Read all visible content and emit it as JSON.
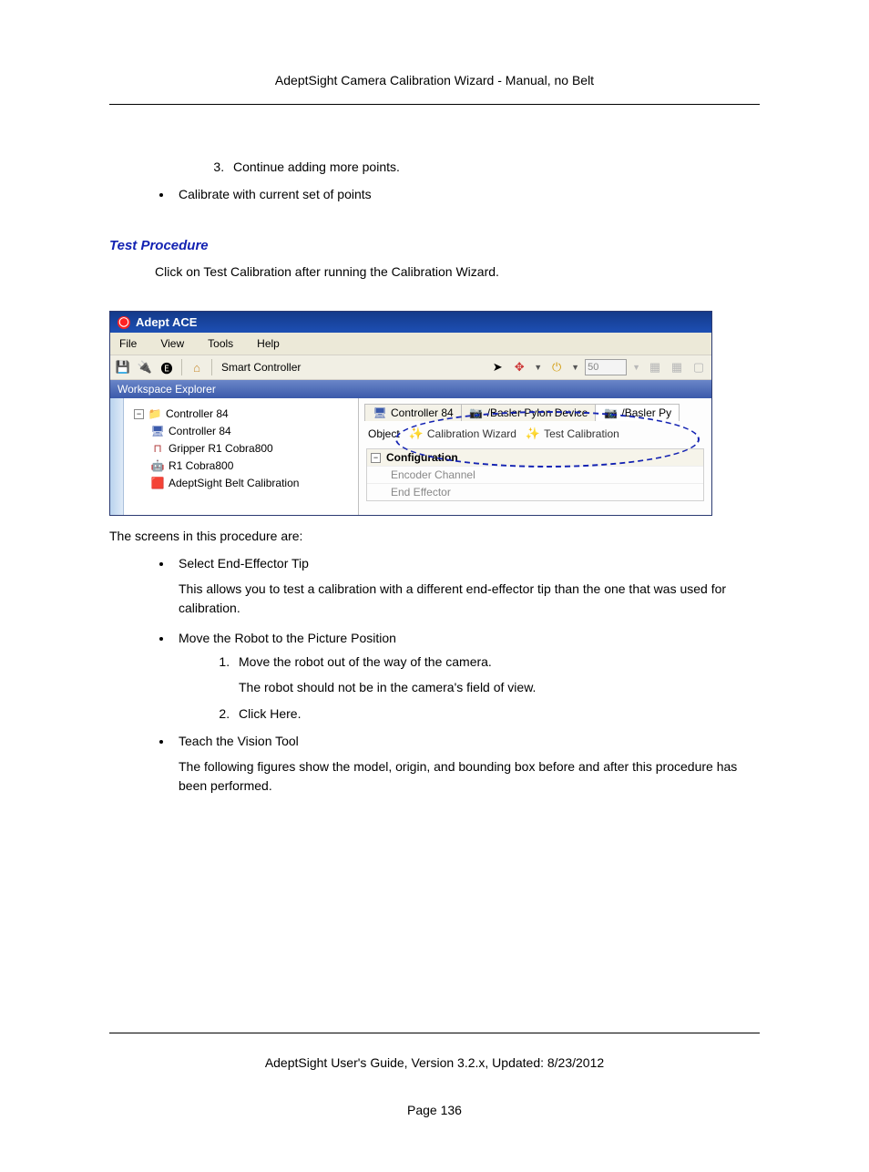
{
  "header": {
    "title": "AdeptSight Camera Calibration Wizard - Manual, no Belt"
  },
  "top_list": {
    "ol3": "Continue adding more points.",
    "bullet": "Calibrate with current set of points"
  },
  "section": {
    "heading": "Test Procedure",
    "intro": "Click on Test Calibration after running the Calibration Wizard."
  },
  "screenshot": {
    "app_title": "Adept ACE",
    "menus": {
      "file": "File",
      "view": "View",
      "tools": "Tools",
      "help": "Help"
    },
    "toolbar": {
      "smart_controller": "Smart Controller",
      "speed_value": "50"
    },
    "workspace_header": "Workspace Explorer",
    "tree": {
      "root": "Controller 84",
      "ctrl": "Controller 84",
      "gripper": "Gripper R1 Cobra800",
      "r1": "R1 Cobra800",
      "belt": "AdeptSight Belt Calibration"
    },
    "tabs": {
      "t1": "Controller 84",
      "t2": "/Basler Pylon Device",
      "t3": "/Basler Py"
    },
    "subbar": {
      "object": "Object",
      "calib": "Calibration Wizard",
      "test": "Test Calibration"
    },
    "config": {
      "title": "Configuration",
      "enc": "Encoder Channel",
      "eff": "End Effector"
    }
  },
  "after": {
    "lead": "The screens in this procedure are:",
    "b1_title": "Select End-Effector Tip",
    "b1_body": "This allows you to test a calibration with a different end-effector tip than the one that was used for calibration.",
    "b2_title": "Move the Robot to the Picture Position",
    "b2_ol1": "Move the robot out of the way of the camera.",
    "b2_ol1_body": "The robot should not be in the camera's field of view.",
    "b2_ol2": "Click Here.",
    "b3_title": "Teach the Vision Tool",
    "b3_body": "The following figures show the model, origin, and bounding box before and after this procedure has been performed."
  },
  "footer": {
    "text": "AdeptSight User's Guide,  Version 3.2.x, Updated: 8/23/2012",
    "page": "Page 136"
  }
}
